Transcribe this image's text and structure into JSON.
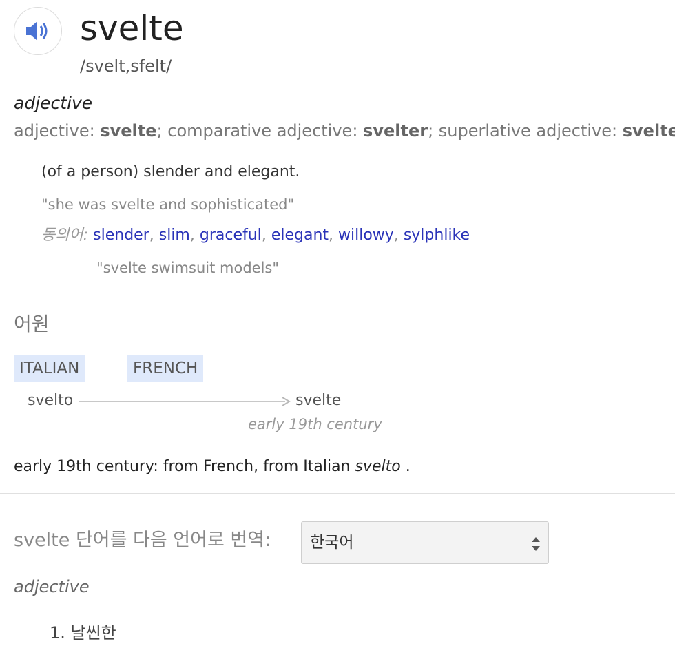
{
  "entry": {
    "word": "svelte",
    "phonetic": "/svelt,sfelt/",
    "part_of_speech": "adjective",
    "forms": {
      "label1": "adjective: ",
      "base": "svelte",
      "label2": "; comparative adjective: ",
      "comparative": "svelter",
      "label3": "; superlative adjective: ",
      "superlative": "sveltest"
    },
    "definition": "(of a person) slender and elegant.",
    "example": "\"she was svelte and sophisticated\"",
    "synonyms_label": "동의어:",
    "synonyms": [
      "slender",
      "slim",
      "graceful",
      "elegant",
      "willowy",
      "sylphlike"
    ],
    "synonym_example": "\"svelte swimsuit models\""
  },
  "etymology": {
    "heading": "어원",
    "languages": [
      "ITALIAN",
      "FRENCH"
    ],
    "from_word": "svelto",
    "to_word": "svelte",
    "period": "early 19th century",
    "origin_text": "early 19th century: from French, from Italian ",
    "origin_word": "svelto",
    "origin_end": " ."
  },
  "translate": {
    "label": "svelte 단어를 다음 언어로 번역:",
    "selected_language": "한국어",
    "part_of_speech": "adjective",
    "items": [
      "1. 날씬한"
    ]
  }
}
